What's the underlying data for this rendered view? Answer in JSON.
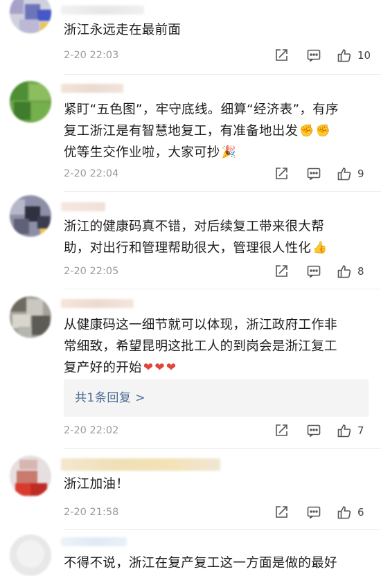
{
  "comments": [
    {
      "text_lines": [
        "浙江永远走在最前面"
      ],
      "time": "2-20 22:03",
      "likes": "10",
      "emoji": []
    },
    {
      "text_lines": [
        "紧盯“五色图”，牢守底线。细算“经济表”，有序",
        "复工浙江是有智慧地复工，有准备地出发",
        "优等生交作业啦，大家可抄"
      ],
      "time": "2-20 22:04",
      "likes": "9",
      "emoji": [
        "fist-emoji",
        "fist-emoji",
        "fire-cracker-emoji"
      ]
    },
    {
      "text_lines": [
        "浙江的健康码真不错，对后续复工带来很大帮",
        "助，对出行和管理帮助很大，管理很人性化"
      ],
      "time": "2-20 22:05",
      "likes": "8",
      "emoji": [
        "thumbs-up-emoji"
      ]
    },
    {
      "text_lines": [
        "从健康码这一细节就可以体现，浙江政府工作非",
        "常细致，希望昆明这批工人的到岗会是浙江复工",
        "复产好的开始"
      ],
      "time": "2-20 22:02",
      "likes": "7",
      "emoji": [
        "heart-emoji",
        "heart-emoji",
        "heart-emoji"
      ],
      "reply_label": "共1条回复 >"
    },
    {
      "text_lines": [
        "浙江加油！"
      ],
      "time": "2-20 21:58",
      "likes": "6",
      "emoji": []
    },
    {
      "text_lines": [
        "不得不说，浙江在复产复工这一方面是做的最好"
      ],
      "time": "",
      "likes": "",
      "emoji": []
    }
  ],
  "colors": {
    "link": "#4a6b94",
    "meta": "#9a9a9a",
    "heart": "#e0453c",
    "emoji_yellow": "#f3c04a"
  },
  "icons": {
    "share": "share-icon",
    "comment": "comment-icon",
    "like": "thumbs-up-icon"
  }
}
